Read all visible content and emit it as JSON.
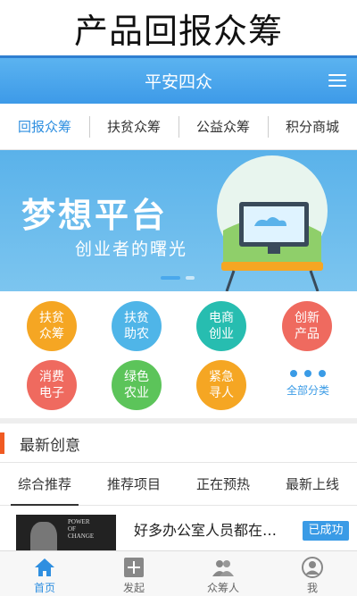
{
  "page_title": "产品回报众筹",
  "appbar": {
    "title": "平安四众",
    "menu_icon": "menu-icon"
  },
  "tabs": [
    {
      "label": "回报众筹",
      "active": true
    },
    {
      "label": "扶贫众筹",
      "active": false
    },
    {
      "label": "公益众筹",
      "active": false
    },
    {
      "label": "积分商城",
      "active": false
    }
  ],
  "banner": {
    "headline": "梦想平台",
    "subtitle": "创业者的曙光",
    "slide_index": 1,
    "slide_count": 2
  },
  "categories": [
    {
      "label": "扶贫众筹",
      "color": "#f5a623"
    },
    {
      "label": "扶贫助农",
      "color": "#4fb5e8"
    },
    {
      "label": "电商创业",
      "color": "#27bdb0"
    },
    {
      "label": "创新产品",
      "color": "#ef6a5f"
    },
    {
      "label": "消费电子",
      "color": "#ef6a5f"
    },
    {
      "label": "绿色农业",
      "color": "#5cc45a"
    },
    {
      "label": "紧急寻人",
      "color": "#f5a623"
    }
  ],
  "more_categories": "全部分类",
  "section": {
    "title": "最新创意",
    "accent": "#f05a22"
  },
  "subtabs": [
    {
      "label": "综合推荐",
      "active": true
    },
    {
      "label": "推荐项目",
      "active": false
    },
    {
      "label": "正在预热",
      "active": false
    },
    {
      "label": "最新上线",
      "active": false
    }
  ],
  "item": {
    "thumb_text_1": "POWER",
    "thumb_text_2": "OF",
    "thumb_text_3": "CHANGE",
    "title": "好多办公室人员都在…",
    "badge": "已成功"
  },
  "bottom_nav": [
    {
      "label": "首页",
      "icon": "home-icon",
      "active": true
    },
    {
      "label": "发起",
      "icon": "plus-icon",
      "active": false
    },
    {
      "label": "众筹人",
      "icon": "people-icon",
      "active": false
    },
    {
      "label": "我",
      "icon": "user-icon",
      "active": false
    }
  ],
  "colors": {
    "primary": "#3d9ae8",
    "accent": "#f05a22"
  }
}
